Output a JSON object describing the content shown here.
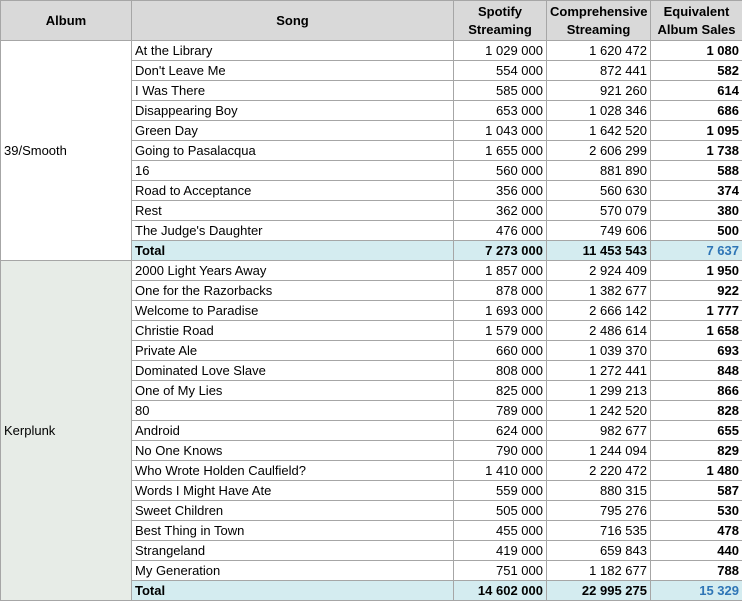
{
  "headers": {
    "album": "Album",
    "song": "Song",
    "spotify": [
      "Spotify",
      "Streaming"
    ],
    "comprehensive": [
      "Comprehensive",
      "Streaming"
    ],
    "equivalent": [
      "Equivalent",
      "Album Sales"
    ]
  },
  "albums": [
    {
      "name": "39/Smooth",
      "rows": [
        {
          "song": "At the Library",
          "spotify": "1 029 000",
          "comp": "1 620 472",
          "eq": "1 080"
        },
        {
          "song": "Don't Leave Me",
          "spotify": "554 000",
          "comp": "872 441",
          "eq": "582"
        },
        {
          "song": "I Was There",
          "spotify": "585 000",
          "comp": "921 260",
          "eq": "614"
        },
        {
          "song": "Disappearing Boy",
          "spotify": "653 000",
          "comp": "1 028 346",
          "eq": "686"
        },
        {
          "song": "Green Day",
          "spotify": "1 043 000",
          "comp": "1 642 520",
          "eq": "1 095"
        },
        {
          "song": "Going to Pasalacqua",
          "spotify": "1 655 000",
          "comp": "2 606 299",
          "eq": "1 738"
        },
        {
          "song": "16",
          "spotify": "560 000",
          "comp": "881 890",
          "eq": "588"
        },
        {
          "song": "Road to Acceptance",
          "spotify": "356 000",
          "comp": "560 630",
          "eq": "374"
        },
        {
          "song": "Rest",
          "spotify": "362 000",
          "comp": "570 079",
          "eq": "380"
        },
        {
          "song": "The Judge's Daughter",
          "spotify": "476 000",
          "comp": "749 606",
          "eq": "500"
        }
      ],
      "total": {
        "label": "Total",
        "spotify": "7 273 000",
        "comp": "11 453 543",
        "eq": "7 637"
      }
    },
    {
      "name": "Kerplunk",
      "rows": [
        {
          "song": "2000 Light Years Away",
          "spotify": "1 857 000",
          "comp": "2 924 409",
          "eq": "1 950"
        },
        {
          "song": "One for the Razorbacks",
          "spotify": "878 000",
          "comp": "1 382 677",
          "eq": "922"
        },
        {
          "song": "Welcome to Paradise",
          "spotify": "1 693 000",
          "comp": "2 666 142",
          "eq": "1 777"
        },
        {
          "song": "Christie Road",
          "spotify": "1 579 000",
          "comp": "2 486 614",
          "eq": "1 658"
        },
        {
          "song": "Private Ale",
          "spotify": "660 000",
          "comp": "1 039 370",
          "eq": "693"
        },
        {
          "song": "Dominated Love Slave",
          "spotify": "808 000",
          "comp": "1 272 441",
          "eq": "848"
        },
        {
          "song": "One of My Lies",
          "spotify": "825 000",
          "comp": "1 299 213",
          "eq": "866"
        },
        {
          "song": "80",
          "spotify": "789 000",
          "comp": "1 242 520",
          "eq": "828"
        },
        {
          "song": "Android",
          "spotify": "624 000",
          "comp": "982 677",
          "eq": "655"
        },
        {
          "song": "No One Knows",
          "spotify": "790 000",
          "comp": "1 244 094",
          "eq": "829"
        },
        {
          "song": "Who Wrote Holden Caulfield?",
          "spotify": "1 410 000",
          "comp": "2 220 472",
          "eq": "1 480"
        },
        {
          "song": "Words I Might Have Ate",
          "spotify": "559 000",
          "comp": "880 315",
          "eq": "587"
        },
        {
          "song": "Sweet Children",
          "spotify": "505 000",
          "comp": "795 276",
          "eq": "530"
        },
        {
          "song": "Best Thing in Town",
          "spotify": "455 000",
          "comp": "716 535",
          "eq": "478"
        },
        {
          "song": "Strangeland",
          "spotify": "419 000",
          "comp": "659 843",
          "eq": "440"
        },
        {
          "song": "My Generation",
          "spotify": "751 000",
          "comp": "1 182 677",
          "eq": "788"
        }
      ],
      "total": {
        "label": "Total",
        "spotify": "14 602 000",
        "comp": "22 995 275",
        "eq": "15 329"
      }
    }
  ]
}
